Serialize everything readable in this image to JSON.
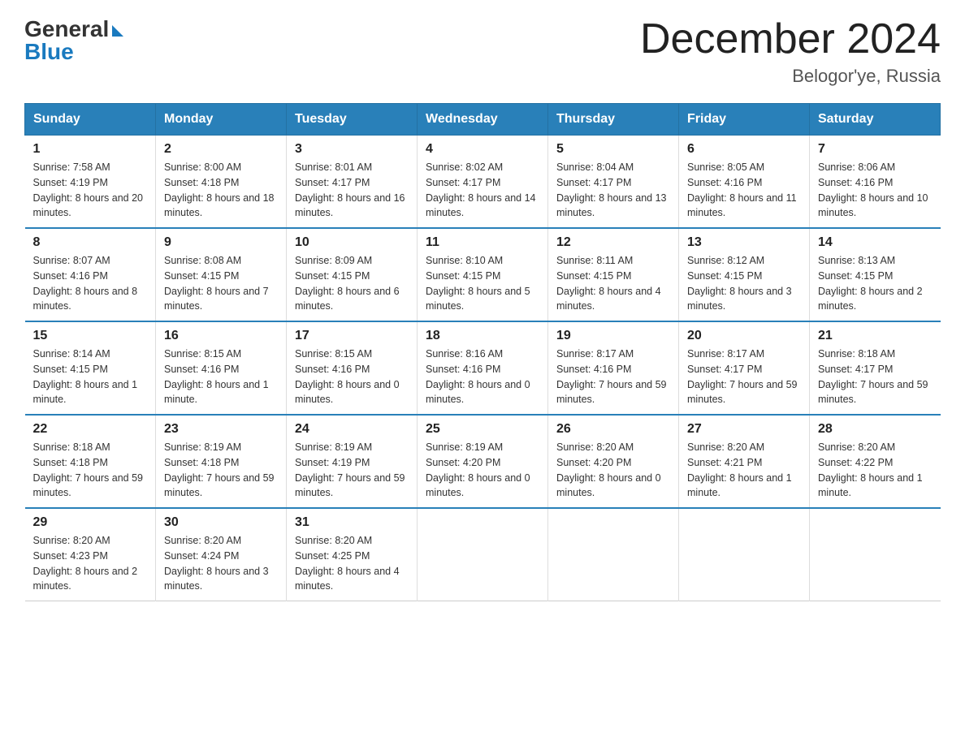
{
  "header": {
    "logo_general": "General",
    "logo_blue": "Blue",
    "month": "December 2024",
    "location": "Belogor'ye, Russia"
  },
  "weekdays": [
    "Sunday",
    "Monday",
    "Tuesday",
    "Wednesday",
    "Thursday",
    "Friday",
    "Saturday"
  ],
  "weeks": [
    [
      {
        "day": "1",
        "sunrise": "7:58 AM",
        "sunset": "4:19 PM",
        "daylight": "8 hours and 20 minutes."
      },
      {
        "day": "2",
        "sunrise": "8:00 AM",
        "sunset": "4:18 PM",
        "daylight": "8 hours and 18 minutes."
      },
      {
        "day": "3",
        "sunrise": "8:01 AM",
        "sunset": "4:17 PM",
        "daylight": "8 hours and 16 minutes."
      },
      {
        "day": "4",
        "sunrise": "8:02 AM",
        "sunset": "4:17 PM",
        "daylight": "8 hours and 14 minutes."
      },
      {
        "day": "5",
        "sunrise": "8:04 AM",
        "sunset": "4:17 PM",
        "daylight": "8 hours and 13 minutes."
      },
      {
        "day": "6",
        "sunrise": "8:05 AM",
        "sunset": "4:16 PM",
        "daylight": "8 hours and 11 minutes."
      },
      {
        "day": "7",
        "sunrise": "8:06 AM",
        "sunset": "4:16 PM",
        "daylight": "8 hours and 10 minutes."
      }
    ],
    [
      {
        "day": "8",
        "sunrise": "8:07 AM",
        "sunset": "4:16 PM",
        "daylight": "8 hours and 8 minutes."
      },
      {
        "day": "9",
        "sunrise": "8:08 AM",
        "sunset": "4:15 PM",
        "daylight": "8 hours and 7 minutes."
      },
      {
        "day": "10",
        "sunrise": "8:09 AM",
        "sunset": "4:15 PM",
        "daylight": "8 hours and 6 minutes."
      },
      {
        "day": "11",
        "sunrise": "8:10 AM",
        "sunset": "4:15 PM",
        "daylight": "8 hours and 5 minutes."
      },
      {
        "day": "12",
        "sunrise": "8:11 AM",
        "sunset": "4:15 PM",
        "daylight": "8 hours and 4 minutes."
      },
      {
        "day": "13",
        "sunrise": "8:12 AM",
        "sunset": "4:15 PM",
        "daylight": "8 hours and 3 minutes."
      },
      {
        "day": "14",
        "sunrise": "8:13 AM",
        "sunset": "4:15 PM",
        "daylight": "8 hours and 2 minutes."
      }
    ],
    [
      {
        "day": "15",
        "sunrise": "8:14 AM",
        "sunset": "4:15 PM",
        "daylight": "8 hours and 1 minute."
      },
      {
        "day": "16",
        "sunrise": "8:15 AM",
        "sunset": "4:16 PM",
        "daylight": "8 hours and 1 minute."
      },
      {
        "day": "17",
        "sunrise": "8:15 AM",
        "sunset": "4:16 PM",
        "daylight": "8 hours and 0 minutes."
      },
      {
        "day": "18",
        "sunrise": "8:16 AM",
        "sunset": "4:16 PM",
        "daylight": "8 hours and 0 minutes."
      },
      {
        "day": "19",
        "sunrise": "8:17 AM",
        "sunset": "4:16 PM",
        "daylight": "7 hours and 59 minutes."
      },
      {
        "day": "20",
        "sunrise": "8:17 AM",
        "sunset": "4:17 PM",
        "daylight": "7 hours and 59 minutes."
      },
      {
        "day": "21",
        "sunrise": "8:18 AM",
        "sunset": "4:17 PM",
        "daylight": "7 hours and 59 minutes."
      }
    ],
    [
      {
        "day": "22",
        "sunrise": "8:18 AM",
        "sunset": "4:18 PM",
        "daylight": "7 hours and 59 minutes."
      },
      {
        "day": "23",
        "sunrise": "8:19 AM",
        "sunset": "4:18 PM",
        "daylight": "7 hours and 59 minutes."
      },
      {
        "day": "24",
        "sunrise": "8:19 AM",
        "sunset": "4:19 PM",
        "daylight": "7 hours and 59 minutes."
      },
      {
        "day": "25",
        "sunrise": "8:19 AM",
        "sunset": "4:20 PM",
        "daylight": "8 hours and 0 minutes."
      },
      {
        "day": "26",
        "sunrise": "8:20 AM",
        "sunset": "4:20 PM",
        "daylight": "8 hours and 0 minutes."
      },
      {
        "day": "27",
        "sunrise": "8:20 AM",
        "sunset": "4:21 PM",
        "daylight": "8 hours and 1 minute."
      },
      {
        "day": "28",
        "sunrise": "8:20 AM",
        "sunset": "4:22 PM",
        "daylight": "8 hours and 1 minute."
      }
    ],
    [
      {
        "day": "29",
        "sunrise": "8:20 AM",
        "sunset": "4:23 PM",
        "daylight": "8 hours and 2 minutes."
      },
      {
        "day": "30",
        "sunrise": "8:20 AM",
        "sunset": "4:24 PM",
        "daylight": "8 hours and 3 minutes."
      },
      {
        "day": "31",
        "sunrise": "8:20 AM",
        "sunset": "4:25 PM",
        "daylight": "8 hours and 4 minutes."
      },
      null,
      null,
      null,
      null
    ]
  ],
  "labels": {
    "sunrise": "Sunrise:",
    "sunset": "Sunset:",
    "daylight": "Daylight:"
  }
}
